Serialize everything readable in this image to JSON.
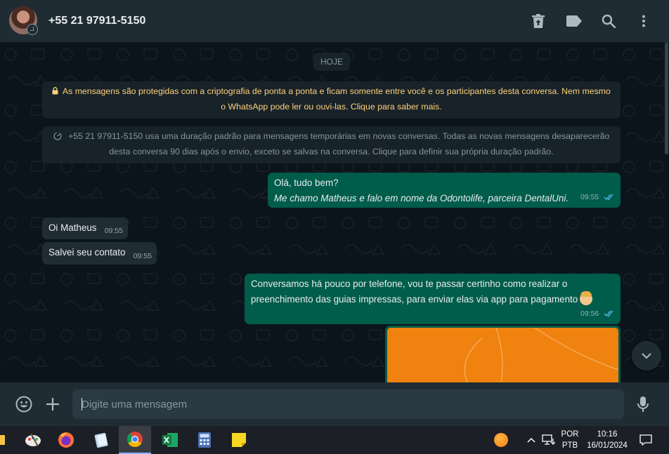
{
  "header": {
    "contact_name": "+55 21 97911-5150"
  },
  "chat": {
    "date_chip": "HOJE",
    "encryption_notice_line1": "As mensagens são protegidas com a criptografia de ponta a ponta e ficam somente entre você e os participantes desta conversa. Nem mesmo",
    "encryption_notice_line2": "o WhatsApp pode ler ou ouvi-las. Clique para saber mais.",
    "disappearing_notice_line1": "+55 21 97911-5150 usa uma duração padrão para mensagens temporárias em novas conversas. Todas as novas mensagens desaparecerão",
    "disappearing_notice_line2": "desta conversa 90 dias após o envio, exceto se salvas na conversa. Clique para definir sua própria duração padrão.",
    "messages": [
      {
        "line1": "Olá, tudo bem?",
        "line2": "Me chamo Matheus e falo em nome da Odontolife, parceira DentalUni.",
        "time": "09:55"
      },
      {
        "text": "Oi Matheus",
        "time": "09:55"
      },
      {
        "text": "Salvei seu contato",
        "time": "09:55"
      },
      {
        "line1": "Conversamos há pouco por telefone, vou te passar certinho como realizar o",
        "line2": "preenchimento das guias impressas, para enviar elas via app para pagamento",
        "time": "09:56"
      }
    ]
  },
  "composer": {
    "placeholder": "Digite uma mensagem"
  },
  "taskbar": {
    "language_line1": "POR",
    "language_line2": "PTB",
    "clock_time": "10:16",
    "clock_date": "16/01/2024"
  },
  "colors": {
    "background": "#0b141a",
    "header": "#202c33",
    "outgoing_bubble": "#005c4b",
    "incoming_bubble": "#202c33",
    "encryption_text": "#ffd279",
    "read_ticks": "#53bdeb",
    "image_preview": "#f0820f"
  }
}
